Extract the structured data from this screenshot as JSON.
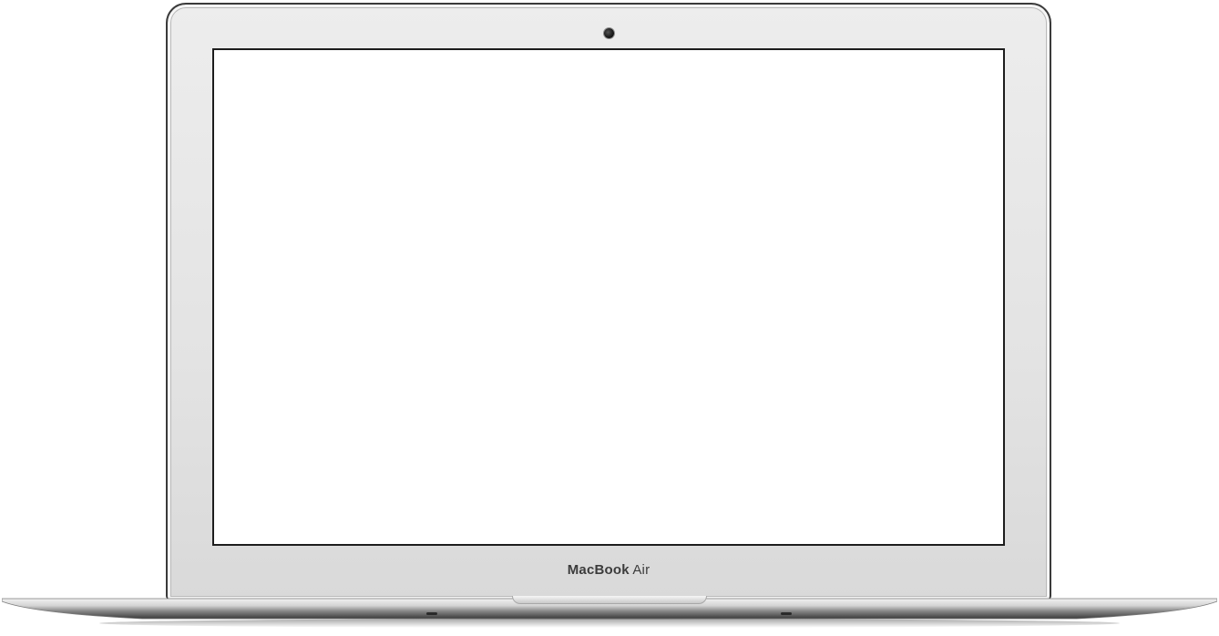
{
  "device": {
    "brand_name_bold": "MacBook",
    "brand_name_regular": "Air"
  },
  "colors": {
    "bezel": "#e6e6e6",
    "screen": "#ffffff",
    "outline": "#2b2b2b"
  }
}
